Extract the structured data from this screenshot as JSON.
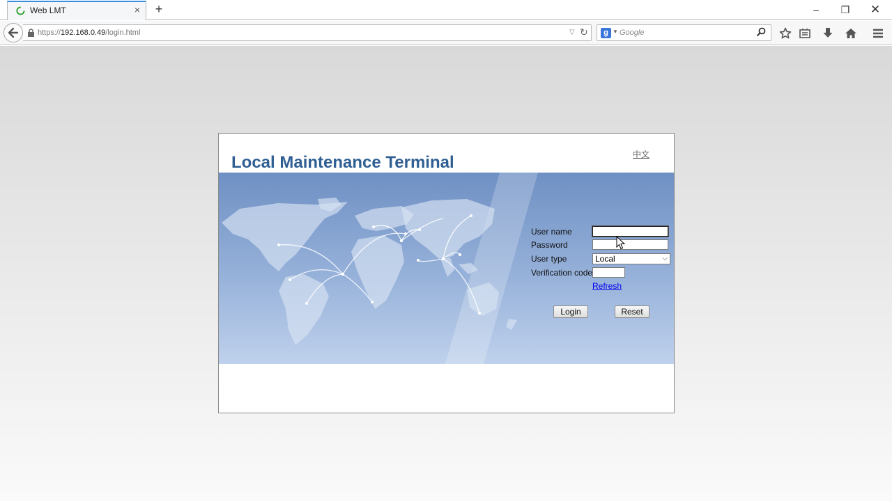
{
  "browser": {
    "tab_title": "Web LMT",
    "tab_close": "×",
    "new_tab": "+",
    "url_scheme": "https://",
    "url_host": "192.168.0.49",
    "url_path": "/login.html",
    "search_placeholder": "Google",
    "search_engine_letter": "g",
    "window_controls": {
      "minimize": "–",
      "restore": "❐",
      "close": "✕"
    }
  },
  "login": {
    "app_title": "Local Maintenance Terminal",
    "language_link": "中文",
    "fields": {
      "username_label": "User name",
      "username_value": "",
      "password_label": "Password",
      "password_value": "",
      "usertype_label": "User type",
      "usertype_value": "Local",
      "verification_label": "Verification code",
      "verification_value": ""
    },
    "refresh_link": "Refresh",
    "login_button": "Login",
    "reset_button": "Reset"
  },
  "colors": {
    "title": "#2f5f93",
    "banner_top": "#6f90c4",
    "banner_bottom": "#bfd1ec",
    "tab_accent": "#3b8fe0",
    "link": "#0000ee"
  },
  "icons": [
    "loading-favicon-icon",
    "back-arrow-icon",
    "lock-icon",
    "reload-icon",
    "search-icon",
    "star-icon",
    "reader-icon",
    "download-icon",
    "home-icon",
    "menu-icon",
    "mouse-cursor-icon",
    "chevron-down-icon"
  ]
}
